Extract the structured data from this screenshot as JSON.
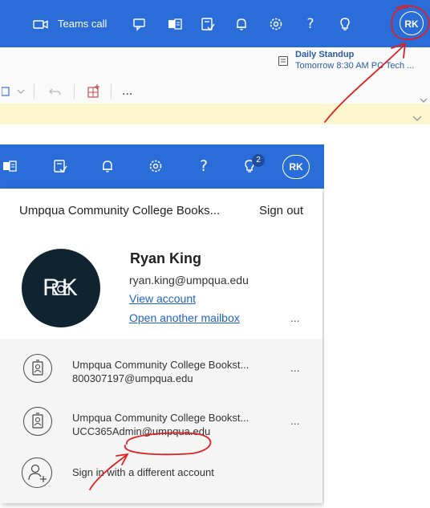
{
  "top_header": {
    "teams_call_label": "Teams call",
    "avatar_initials": "RK",
    "meeting": {
      "title": "Daily Standup",
      "details": "Tomorrow 8:30 AM PC Tech ..."
    },
    "toolbar_more": "..."
  },
  "panel_header": {
    "notification_badge": "2",
    "avatar_initials": "RK"
  },
  "account_panel": {
    "org_name": "Umpqua Community College Books...",
    "sign_out_label": "Sign out",
    "avatar_text": "RK",
    "user_name": "Ryan King",
    "user_email": "ryan.king@umpqua.edu",
    "view_account_label": "View account",
    "open_mailbox_label": "Open another mailbox",
    "more_label": "...",
    "other_accounts": [
      {
        "name": "Umpqua Community College Bookst...",
        "email": "800307197@umpqua.edu",
        "more": "..."
      },
      {
        "name": "Umpqua Community College Bookst...",
        "email": "UCC365Admin@umpqua.edu",
        "more": "..."
      }
    ],
    "different_account_label": "Sign in with a different account"
  },
  "colors": {
    "header_blue": "#2a6dd8",
    "link_blue": "#1f62c8",
    "annotation_red": "#e02020",
    "avatar_dark": "#0f2331",
    "banner_yellow": "#fdf6cf"
  }
}
